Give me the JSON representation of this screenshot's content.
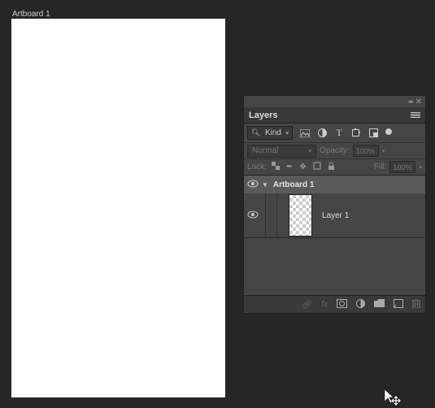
{
  "artboard": {
    "label": "Artboard 1"
  },
  "panel": {
    "title": "Layers",
    "filter": {
      "kind_label": "Kind",
      "icons": [
        "image-icon",
        "adjustment-icon",
        "type-icon",
        "shape-icon",
        "smartobject-icon"
      ]
    },
    "blend": {
      "mode": "Normal",
      "opacity_label": "Opacity:",
      "opacity_value": "100%",
      "fill_label": "Fill:",
      "fill_value": "100%",
      "lock_label": "Lock:"
    },
    "tree": {
      "artboard_name": "Artboard 1",
      "layer_name": "Layer 1"
    },
    "footer": {
      "icons": [
        "link-icon",
        "fx-icon",
        "mask-icon",
        "adjustment-fill-icon",
        "group-icon",
        "new-layer-icon",
        "trash-icon"
      ]
    }
  }
}
